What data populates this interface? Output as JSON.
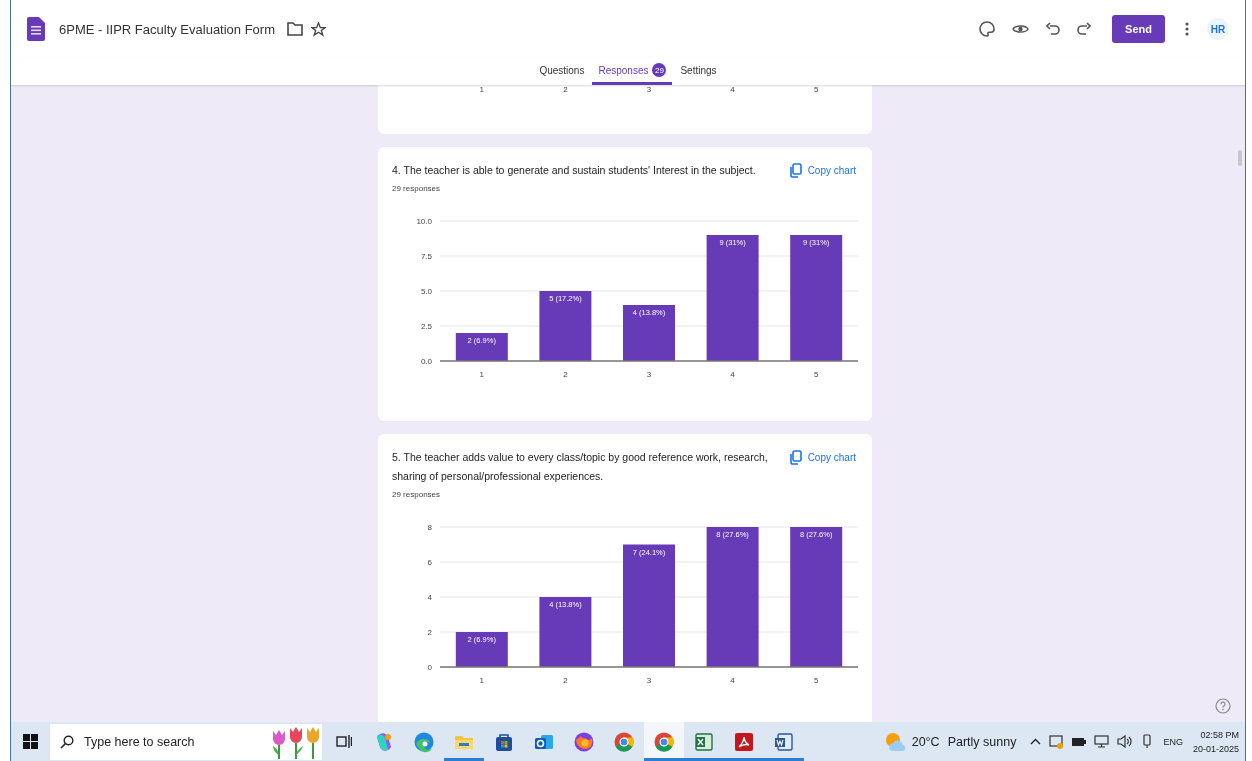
{
  "header": {
    "title": "6PME - IIPR Faculty Evaluation Form",
    "send_button": "Send",
    "avatar": "HR"
  },
  "tabs": [
    {
      "label": "Questions",
      "selected": false
    },
    {
      "label": "Responses",
      "selected": true,
      "badge": "29"
    },
    {
      "label": "Settings",
      "selected": false
    }
  ],
  "partial_card": {
    "x_labels": [
      "1",
      "2",
      "3",
      "4",
      "5"
    ]
  },
  "questions": [
    {
      "title": "4. The teacher is able to generate and sustain students' Interest in the subject.",
      "copy_label": "Copy chart",
      "responses": "29 responses",
      "chart_data": {
        "type": "bar",
        "categories": [
          "1",
          "2",
          "3",
          "4",
          "5"
        ],
        "values": [
          2,
          5,
          4,
          9,
          9
        ],
        "grid": true,
        "ylim": [
          0,
          10
        ],
        "yticks": [
          {
            "value": 0,
            "label": "0.0"
          },
          {
            "value": 2.5,
            "label": "2.5"
          },
          {
            "value": 5,
            "label": "5.0"
          },
          {
            "value": 7.5,
            "label": "7.5"
          },
          {
            "value": 10,
            "label": "10.0"
          }
        ],
        "value_labels": [
          "2 (6.9%)",
          "5 (17.2%)",
          "4 (13.8%)",
          "9 (31%)",
          "9 (31%)"
        ]
      }
    },
    {
      "title": "5. The teacher adds value to every class/topic by good reference work, research, sharing of personal/professional experiences.",
      "copy_label": "Copy chart",
      "responses": "29 responses",
      "chart_data": {
        "type": "bar",
        "categories": [
          "1",
          "2",
          "3",
          "4",
          "5"
        ],
        "values": [
          2,
          4,
          7,
          8,
          8
        ],
        "grid": true,
        "ylim": [
          0,
          8
        ],
        "yticks": [
          0,
          2,
          4,
          6,
          8
        ],
        "value_labels": [
          "2 (6.9%)",
          "4 (13.8%)",
          "7 (24.1%)",
          "8 (27.6%)",
          "8 (27.6%)"
        ]
      }
    }
  ],
  "taskbar": {
    "search": {
      "placeholder": "Type here to search"
    },
    "apps": [
      {
        "kind": "copilot",
        "running": false,
        "selected": false
      },
      {
        "kind": "edge",
        "running": false,
        "selected": false
      },
      {
        "kind": "explorer",
        "running": true,
        "selected": false
      },
      {
        "kind": "store",
        "running": false,
        "selected": false
      },
      {
        "kind": "outlook",
        "running": false,
        "selected": false
      },
      {
        "kind": "firefox",
        "running": false,
        "selected": false
      },
      {
        "kind": "chrome",
        "running": false,
        "selected": false
      },
      {
        "kind": "chrome",
        "running": true,
        "selected": true
      },
      {
        "kind": "excel",
        "running": true,
        "selected": false
      },
      {
        "kind": "acrobat",
        "running": true,
        "selected": false
      },
      {
        "kind": "word",
        "running": true,
        "selected": false
      }
    ],
    "weather": {
      "temperature": "20°C",
      "condition": "Partly sunny"
    },
    "language": "ENG",
    "time": "02:58 PM",
    "date": "20-01-2025"
  }
}
